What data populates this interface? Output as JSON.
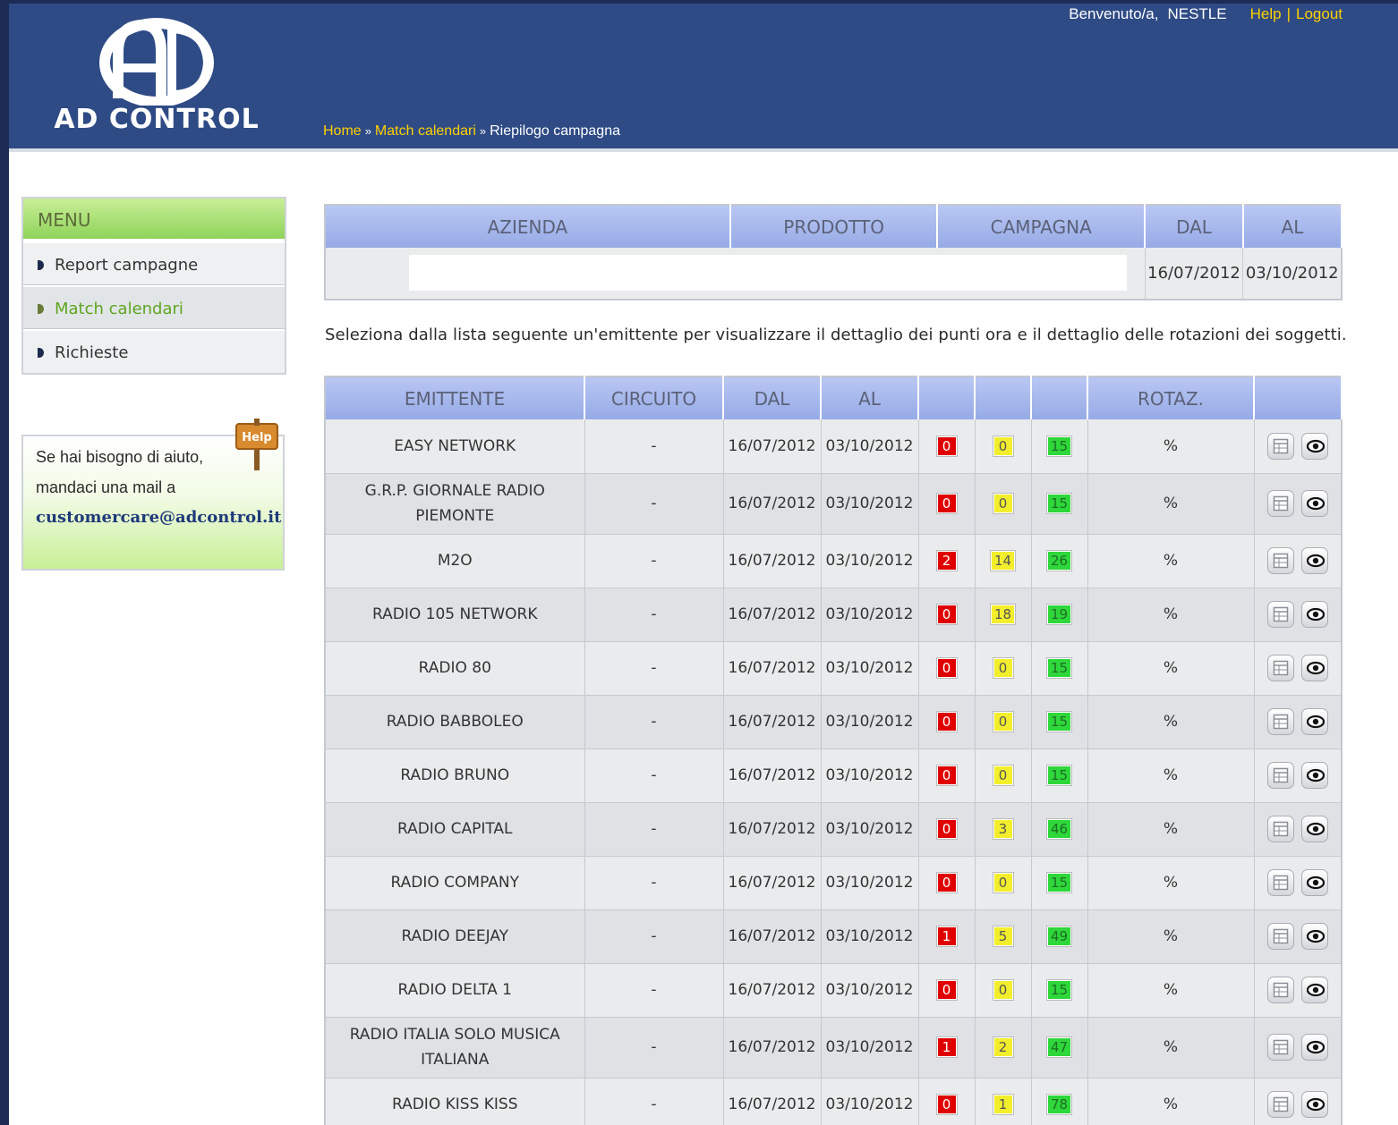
{
  "header": {
    "logo_text": "AD CONTROL",
    "welcome": "Benvenuto/a,",
    "user": "NESTLE",
    "help": "Help",
    "separator": "|",
    "logout": "Logout"
  },
  "breadcrumb": {
    "home": "Home",
    "sep": "»",
    "match": "Match calendari",
    "current": "Riepilogo campagna"
  },
  "sidebar": {
    "menu_title": "MENU",
    "items": [
      {
        "label": "Report campagne"
      },
      {
        "label": "Match calendari"
      },
      {
        "label": "Richieste"
      }
    ],
    "help_sign": "Help",
    "help_line1": "Se hai bisogno di aiuto,",
    "help_line2": "mandaci una mail a",
    "help_email": "customercare@adcontrol.it"
  },
  "campaign": {
    "headers": [
      "AZIENDA",
      "PRODOTTO",
      "CAMPAGNA",
      "DAL",
      "AL"
    ],
    "dal": "16/07/2012",
    "al": "03/10/2012"
  },
  "instruction": "Seleziona dalla lista seguente un'emittente per visualizzare il dettaglio dei punti ora e il dettaglio delle rotazioni dei soggetti.",
  "list": {
    "headers": [
      "EMITTENTE",
      "CIRCUITO",
      "DAL",
      "AL",
      "",
      "",
      "",
      "ROTAZ.",
      ""
    ],
    "rows": [
      {
        "emittente": "EASY NETWORK",
        "circuito": "-",
        "dal": "16/07/2012",
        "al": "03/10/2012",
        "red": "0",
        "yellow": "0",
        "green": "15",
        "rotaz": "%"
      },
      {
        "emittente": "G.R.P. GIORNALE RADIO PIEMONTE",
        "circuito": "-",
        "dal": "16/07/2012",
        "al": "03/10/2012",
        "red": "0",
        "yellow": "0",
        "green": "15",
        "rotaz": "%"
      },
      {
        "emittente": "M2O",
        "circuito": "-",
        "dal": "16/07/2012",
        "al": "03/10/2012",
        "red": "2",
        "yellow": "14",
        "green": "26",
        "rotaz": "%"
      },
      {
        "emittente": "RADIO 105 NETWORK",
        "circuito": "-",
        "dal": "16/07/2012",
        "al": "03/10/2012",
        "red": "0",
        "yellow": "18",
        "green": "19",
        "rotaz": "%"
      },
      {
        "emittente": "RADIO 80",
        "circuito": "-",
        "dal": "16/07/2012",
        "al": "03/10/2012",
        "red": "0",
        "yellow": "0",
        "green": "15",
        "rotaz": "%"
      },
      {
        "emittente": "RADIO BABBOLEO",
        "circuito": "-",
        "dal": "16/07/2012",
        "al": "03/10/2012",
        "red": "0",
        "yellow": "0",
        "green": "15",
        "rotaz": "%"
      },
      {
        "emittente": "RADIO BRUNO",
        "circuito": "-",
        "dal": "16/07/2012",
        "al": "03/10/2012",
        "red": "0",
        "yellow": "0",
        "green": "15",
        "rotaz": "%"
      },
      {
        "emittente": "RADIO CAPITAL",
        "circuito": "-",
        "dal": "16/07/2012",
        "al": "03/10/2012",
        "red": "0",
        "yellow": "3",
        "green": "46",
        "rotaz": "%"
      },
      {
        "emittente": "RADIO COMPANY",
        "circuito": "-",
        "dal": "16/07/2012",
        "al": "03/10/2012",
        "red": "0",
        "yellow": "0",
        "green": "15",
        "rotaz": "%"
      },
      {
        "emittente": "RADIO DEEJAY",
        "circuito": "-",
        "dal": "16/07/2012",
        "al": "03/10/2012",
        "red": "1",
        "yellow": "5",
        "green": "49",
        "rotaz": "%"
      },
      {
        "emittente": "RADIO DELTA 1",
        "circuito": "-",
        "dal": "16/07/2012",
        "al": "03/10/2012",
        "red": "0",
        "yellow": "0",
        "green": "15",
        "rotaz": "%"
      },
      {
        "emittente": "RADIO ITALIA SOLO MUSICA ITALIANA",
        "circuito": "-",
        "dal": "16/07/2012",
        "al": "03/10/2012",
        "red": "1",
        "yellow": "2",
        "green": "47",
        "rotaz": "%"
      },
      {
        "emittente": "RADIO KISS KISS",
        "circuito": "-",
        "dal": "16/07/2012",
        "al": "03/10/2012",
        "red": "0",
        "yellow": "1",
        "green": "78",
        "rotaz": "%"
      }
    ]
  },
  "colors": {
    "header_bg": "#2f4b85",
    "link_yellow": "#ffd000",
    "table_header": "#a6b7ec",
    "badge_red": "#e00000",
    "badge_yellow": "#f3ee2c",
    "badge_green": "#2ed73a",
    "menu_green": "#8fd35a"
  },
  "icons": [
    "calendar-table-icon",
    "eye-icon",
    "help-sign-icon",
    "logo-icon"
  ]
}
